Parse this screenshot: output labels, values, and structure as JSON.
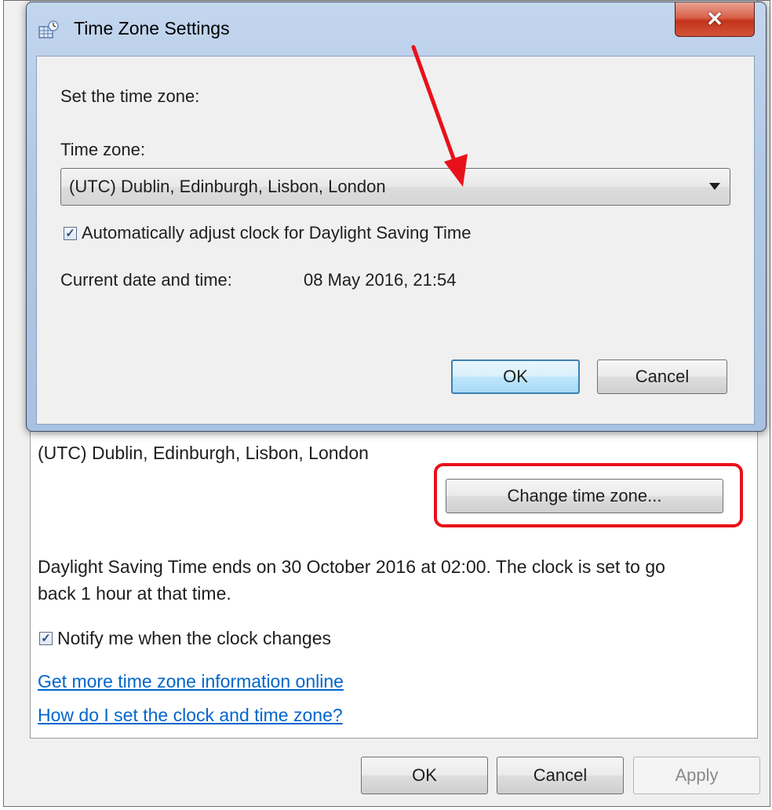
{
  "parent": {
    "current_time_zone": "(UTC) Dublin, Edinburgh, Lisbon, London",
    "change_button_label": "Change time zone...",
    "dst_info": "Daylight Saving Time ends on 30 October 2016 at 02:00. The clock is set to go back 1 hour at that time.",
    "notify_checkbox_label": "Notify me when the clock changes",
    "notify_checked": true,
    "link_more_info": "Get more time zone information online",
    "link_how_to": "How do I set the clock and time zone?",
    "ok_label": "OK",
    "cancel_label": "Cancel",
    "apply_label": "Apply"
  },
  "dialog": {
    "title": "Time Zone Settings",
    "close_icon": "close-icon",
    "intro": "Set the time zone:",
    "time_zone_label": "Time zone:",
    "time_zone_value": "(UTC) Dublin, Edinburgh, Lisbon, London",
    "auto_dst_label": "Automatically adjust clock for Daylight Saving Time",
    "auto_dst_checked": true,
    "current_date_label": "Current date and time:",
    "current_date_value": "08 May 2016, 21:54",
    "ok_label": "OK",
    "cancel_label": "Cancel"
  },
  "annotations": {
    "highlight_color": "#e8111a",
    "arrow_color": "#e8111a"
  }
}
